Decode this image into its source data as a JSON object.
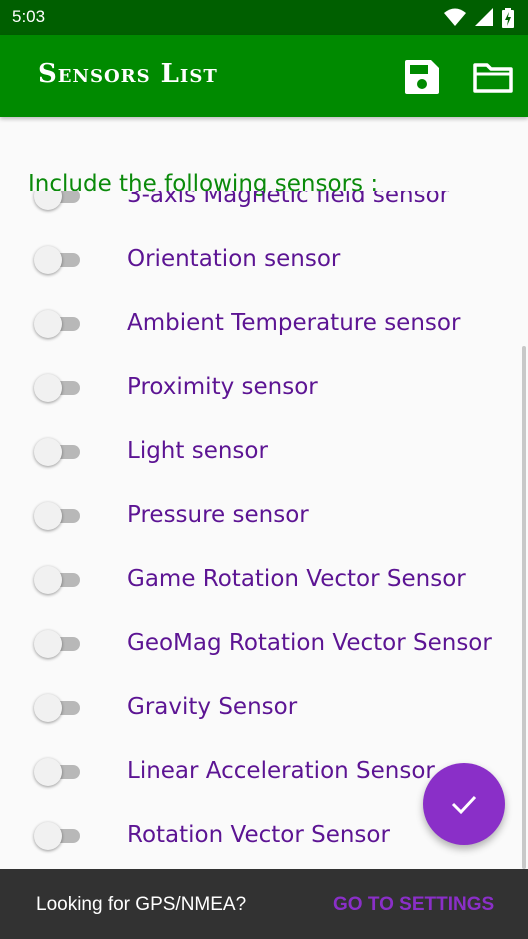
{
  "status_bar": {
    "time": "5:03",
    "icons": [
      "wifi-icon",
      "signal-icon",
      "battery-charging-icon"
    ]
  },
  "app_bar": {
    "title": "Sensors List",
    "actions": [
      "save-icon",
      "folder-icon"
    ],
    "color": "#008a00"
  },
  "content": {
    "header": "Include the following sensors :",
    "sensors": [
      {
        "label": "3-axis Magnetic field sensor",
        "enabled": false
      },
      {
        "label": "Orientation sensor",
        "enabled": false
      },
      {
        "label": "Ambient Temperature sensor",
        "enabled": false
      },
      {
        "label": "Proximity sensor",
        "enabled": false
      },
      {
        "label": "Light sensor",
        "enabled": false
      },
      {
        "label": "Pressure sensor",
        "enabled": false
      },
      {
        "label": "Game Rotation Vector Sensor",
        "enabled": false
      },
      {
        "label": "GeoMag Rotation Vector Sensor",
        "enabled": false
      },
      {
        "label": "Gravity Sensor",
        "enabled": false
      },
      {
        "label": "Linear Acceleration Sensor",
        "enabled": false
      },
      {
        "label": "Rotation Vector Sensor",
        "enabled": false
      }
    ]
  },
  "fab": {
    "icon": "check-icon",
    "color": "#8a2fc8"
  },
  "snackbar": {
    "message": "Looking for GPS/NMEA?",
    "action": "GO TO SETTINGS"
  }
}
